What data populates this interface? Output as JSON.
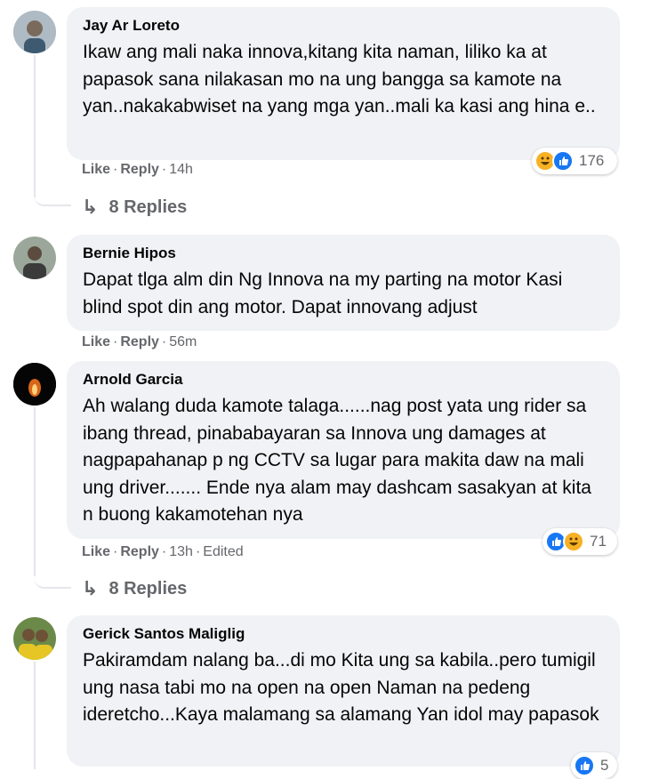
{
  "comments": [
    {
      "author": "Jay Ar Loreto",
      "text": "Ikaw ang mali naka innova,kitang kita naman, liliko ka at papasok sana nilakasan mo na ung bangga sa kamote na yan..nakakabwiset na yang mga yan..mali ka kasi ang hina e..",
      "like": "Like",
      "reply": "Reply",
      "time": "14h",
      "reaction_count": "176",
      "replies_label": "8 Replies"
    },
    {
      "author": "Bernie Hipos",
      "text": "Dapat tlga alm din Ng Innova na my parting na motor Kasi blind spot din ang motor. Dapat innovang adjust",
      "like": "Like",
      "reply": "Reply",
      "time": "56m"
    },
    {
      "author": "Arnold Garcia",
      "text": "Ah walang duda kamote talaga......nag post yata ung rider sa ibang thread, pinababayaran sa Innova ung damages at nagpapahanap p ng CCTV sa lugar para makita daw na mali ung driver....... Ende nya alam may dashcam sasakyan at kita n buong kakamotehan nya",
      "like": "Like",
      "reply": "Reply",
      "time": "13h",
      "edited": "Edited",
      "reaction_count": "71",
      "replies_label": "8 Replies"
    },
    {
      "author": "Gerick Santos Maliglig",
      "text": "Pakiramdam nalang ba...di mo Kita ung sa kabila..pero tumigil ung nasa tabi mo na open na open Naman na pedeng ideretcho...Kaya malamang sa alamang Yan idol may papasok",
      "reaction_count": "5"
    }
  ],
  "colors": {
    "bubble": "#f0f2f5",
    "meta_text": "#65676b",
    "like_blue": "#1877f2",
    "haha_yellow": "#f7b125"
  },
  "icons": [
    "like-reaction-icon",
    "haha-reaction-icon",
    "reply-arrow-icon"
  ]
}
